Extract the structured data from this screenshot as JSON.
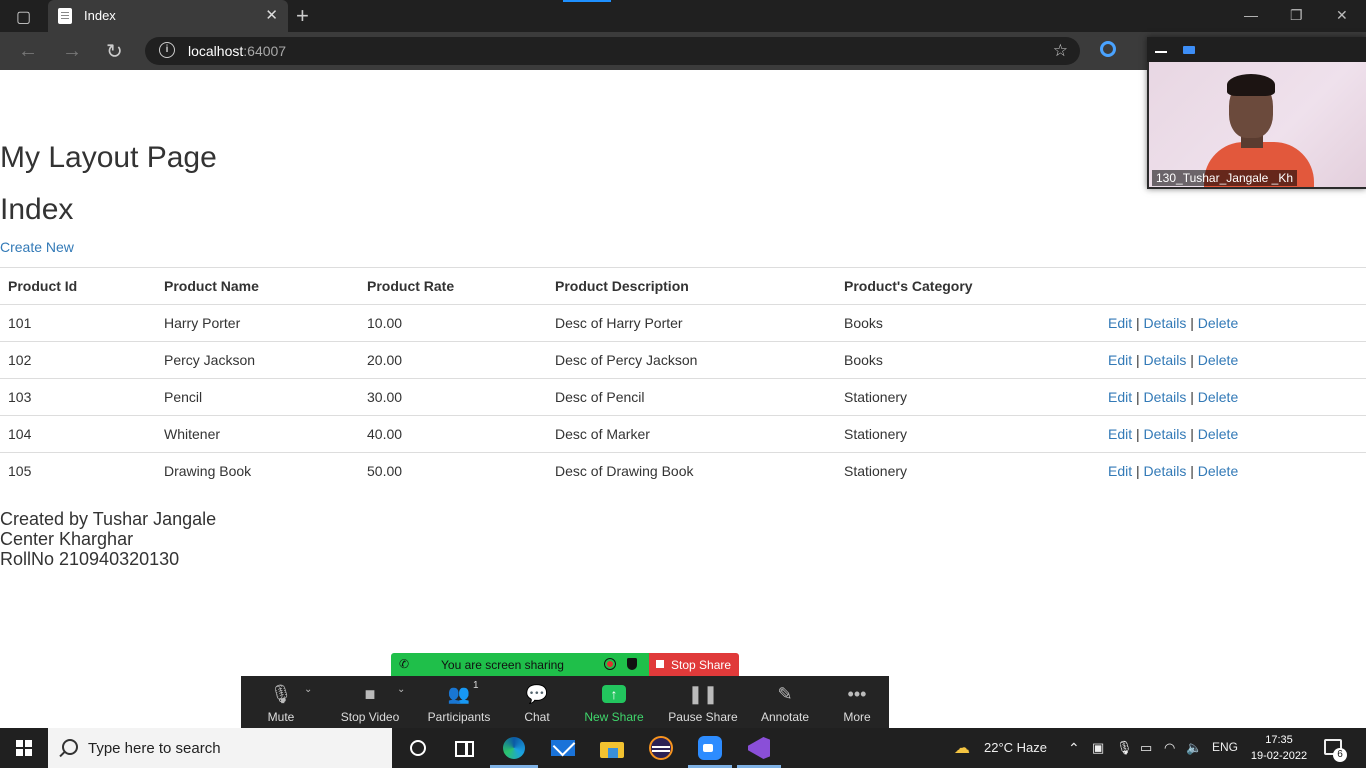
{
  "browser": {
    "tab_title": "Index",
    "tab_close": "✕",
    "new_tab": "+",
    "address_host": "localhost",
    "address_port": ":64007"
  },
  "page": {
    "layout_title": "My Layout Page",
    "heading": "Index",
    "create_new": "Create New",
    "table": {
      "headers": [
        "Product Id",
        "Product Name",
        "Product Rate",
        "Product Description",
        "Product's Category",
        ""
      ],
      "rows": [
        [
          "101",
          "Harry Porter",
          "10.00",
          "Desc of Harry Porter",
          "Books"
        ],
        [
          "102",
          "Percy Jackson",
          "20.00",
          "Desc of Percy Jackson",
          "Books"
        ],
        [
          "103",
          "Pencil",
          "30.00",
          "Desc of Pencil",
          "Stationery"
        ],
        [
          "104",
          "Whitener",
          "40.00",
          "Desc of Marker",
          "Stationery"
        ],
        [
          "105",
          "Drawing Book",
          "50.00",
          "Desc of Drawing Book",
          "Stationery"
        ]
      ],
      "actions": {
        "edit": "Edit",
        "details": "Details",
        "delete": "Delete",
        "sep": " | "
      }
    },
    "footer": {
      "line1": "Created by Tushar Jangale",
      "line2": "Center Kharghar",
      "line3": "RollNo 210940320130"
    }
  },
  "zoom": {
    "participant_name": "130_Tushar_Jangale _Kh",
    "sharing_text": "You are screen sharing",
    "stop_share": "Stop Share",
    "buttons": {
      "mute": "Mute",
      "stop_video": "Stop Video",
      "participants": "Participants",
      "participants_count": "1",
      "chat": "Chat",
      "new_share": "New Share",
      "pause_share": "Pause Share",
      "annotate": "Annotate",
      "more": "More"
    },
    "share_color": "#1fbf4a",
    "stop_color": "#e03a3a"
  },
  "taskbar": {
    "search_placeholder": "Type here to search",
    "weather": "22°C  Haze",
    "language": "ENG",
    "time": "17:35",
    "date": "19-02-2022",
    "notification_count": "6"
  }
}
